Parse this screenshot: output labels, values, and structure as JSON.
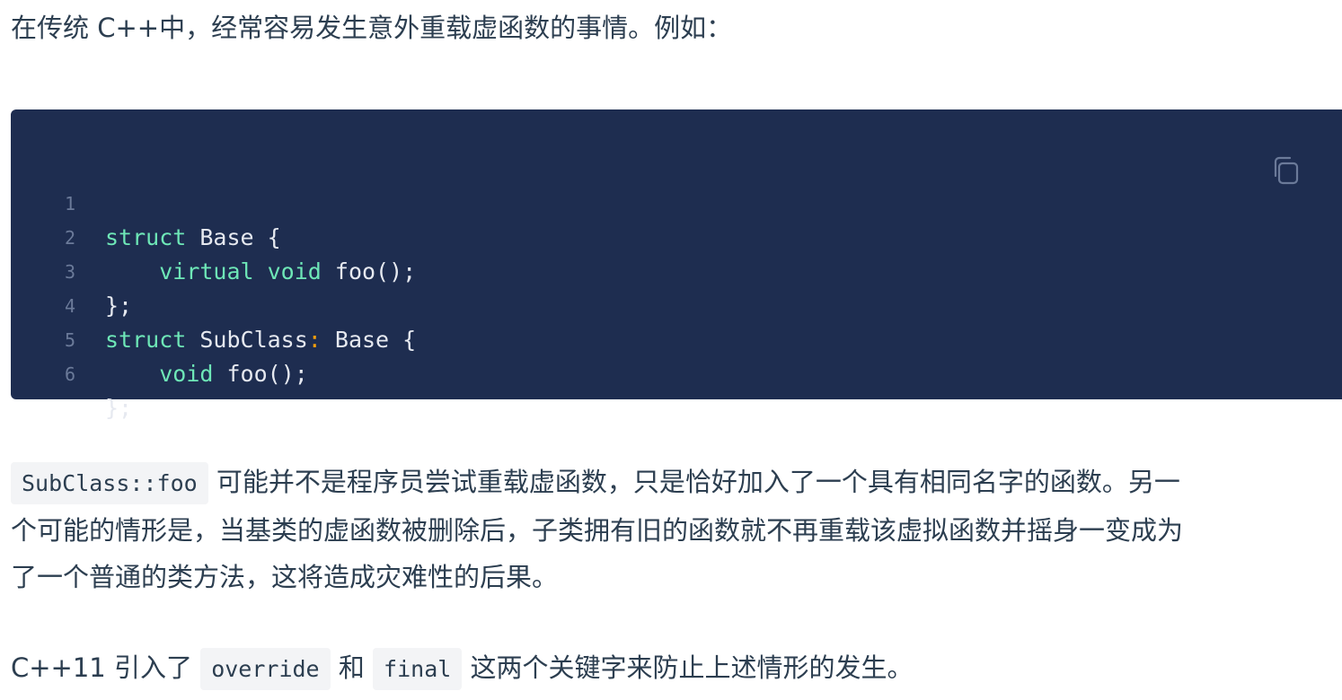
{
  "intro": "在传统 C++中，经常容易发生意外重载虚函数的事情。例如：",
  "code": {
    "lines": [
      {
        "num": "1",
        "indent": "",
        "kw": "struct",
        "rest": " Base {"
      },
      {
        "num": "2",
        "indent": "    ",
        "kw": "virtual void",
        "rest": " foo();"
      },
      {
        "num": "3",
        "indent": "",
        "kw": "",
        "rest": "};"
      },
      {
        "num": "4",
        "indent": "",
        "kw": "struct",
        "rest": " SubClass",
        "colon": ":",
        "rest2": " Base {"
      },
      {
        "num": "5",
        "indent": "    ",
        "kw": "void",
        "rest": " foo();"
      },
      {
        "num": "6",
        "indent": "",
        "kw": "",
        "rest": "};"
      }
    ],
    "copy_icon": "copy-icon"
  },
  "para2": {
    "code": "SubClass::foo",
    "line1": " 可能并不是程序员尝试重载虚函数，只是恰好加入了一个具有相同名字的函数。另一",
    "line2": "个可能的情形是，当基类的虚函数被删除后，子类拥有旧的函数就不再重载该虚拟函数并摇身一变成为",
    "line3": "了一个普通的类方法，这将造成灾难性的后果。"
  },
  "para3": {
    "prefix": "C++11 引入了 ",
    "code1": "override",
    "mid": " 和 ",
    "code2": "final",
    "suffix": " 这两个关键字来防止上述情形的发生。"
  }
}
